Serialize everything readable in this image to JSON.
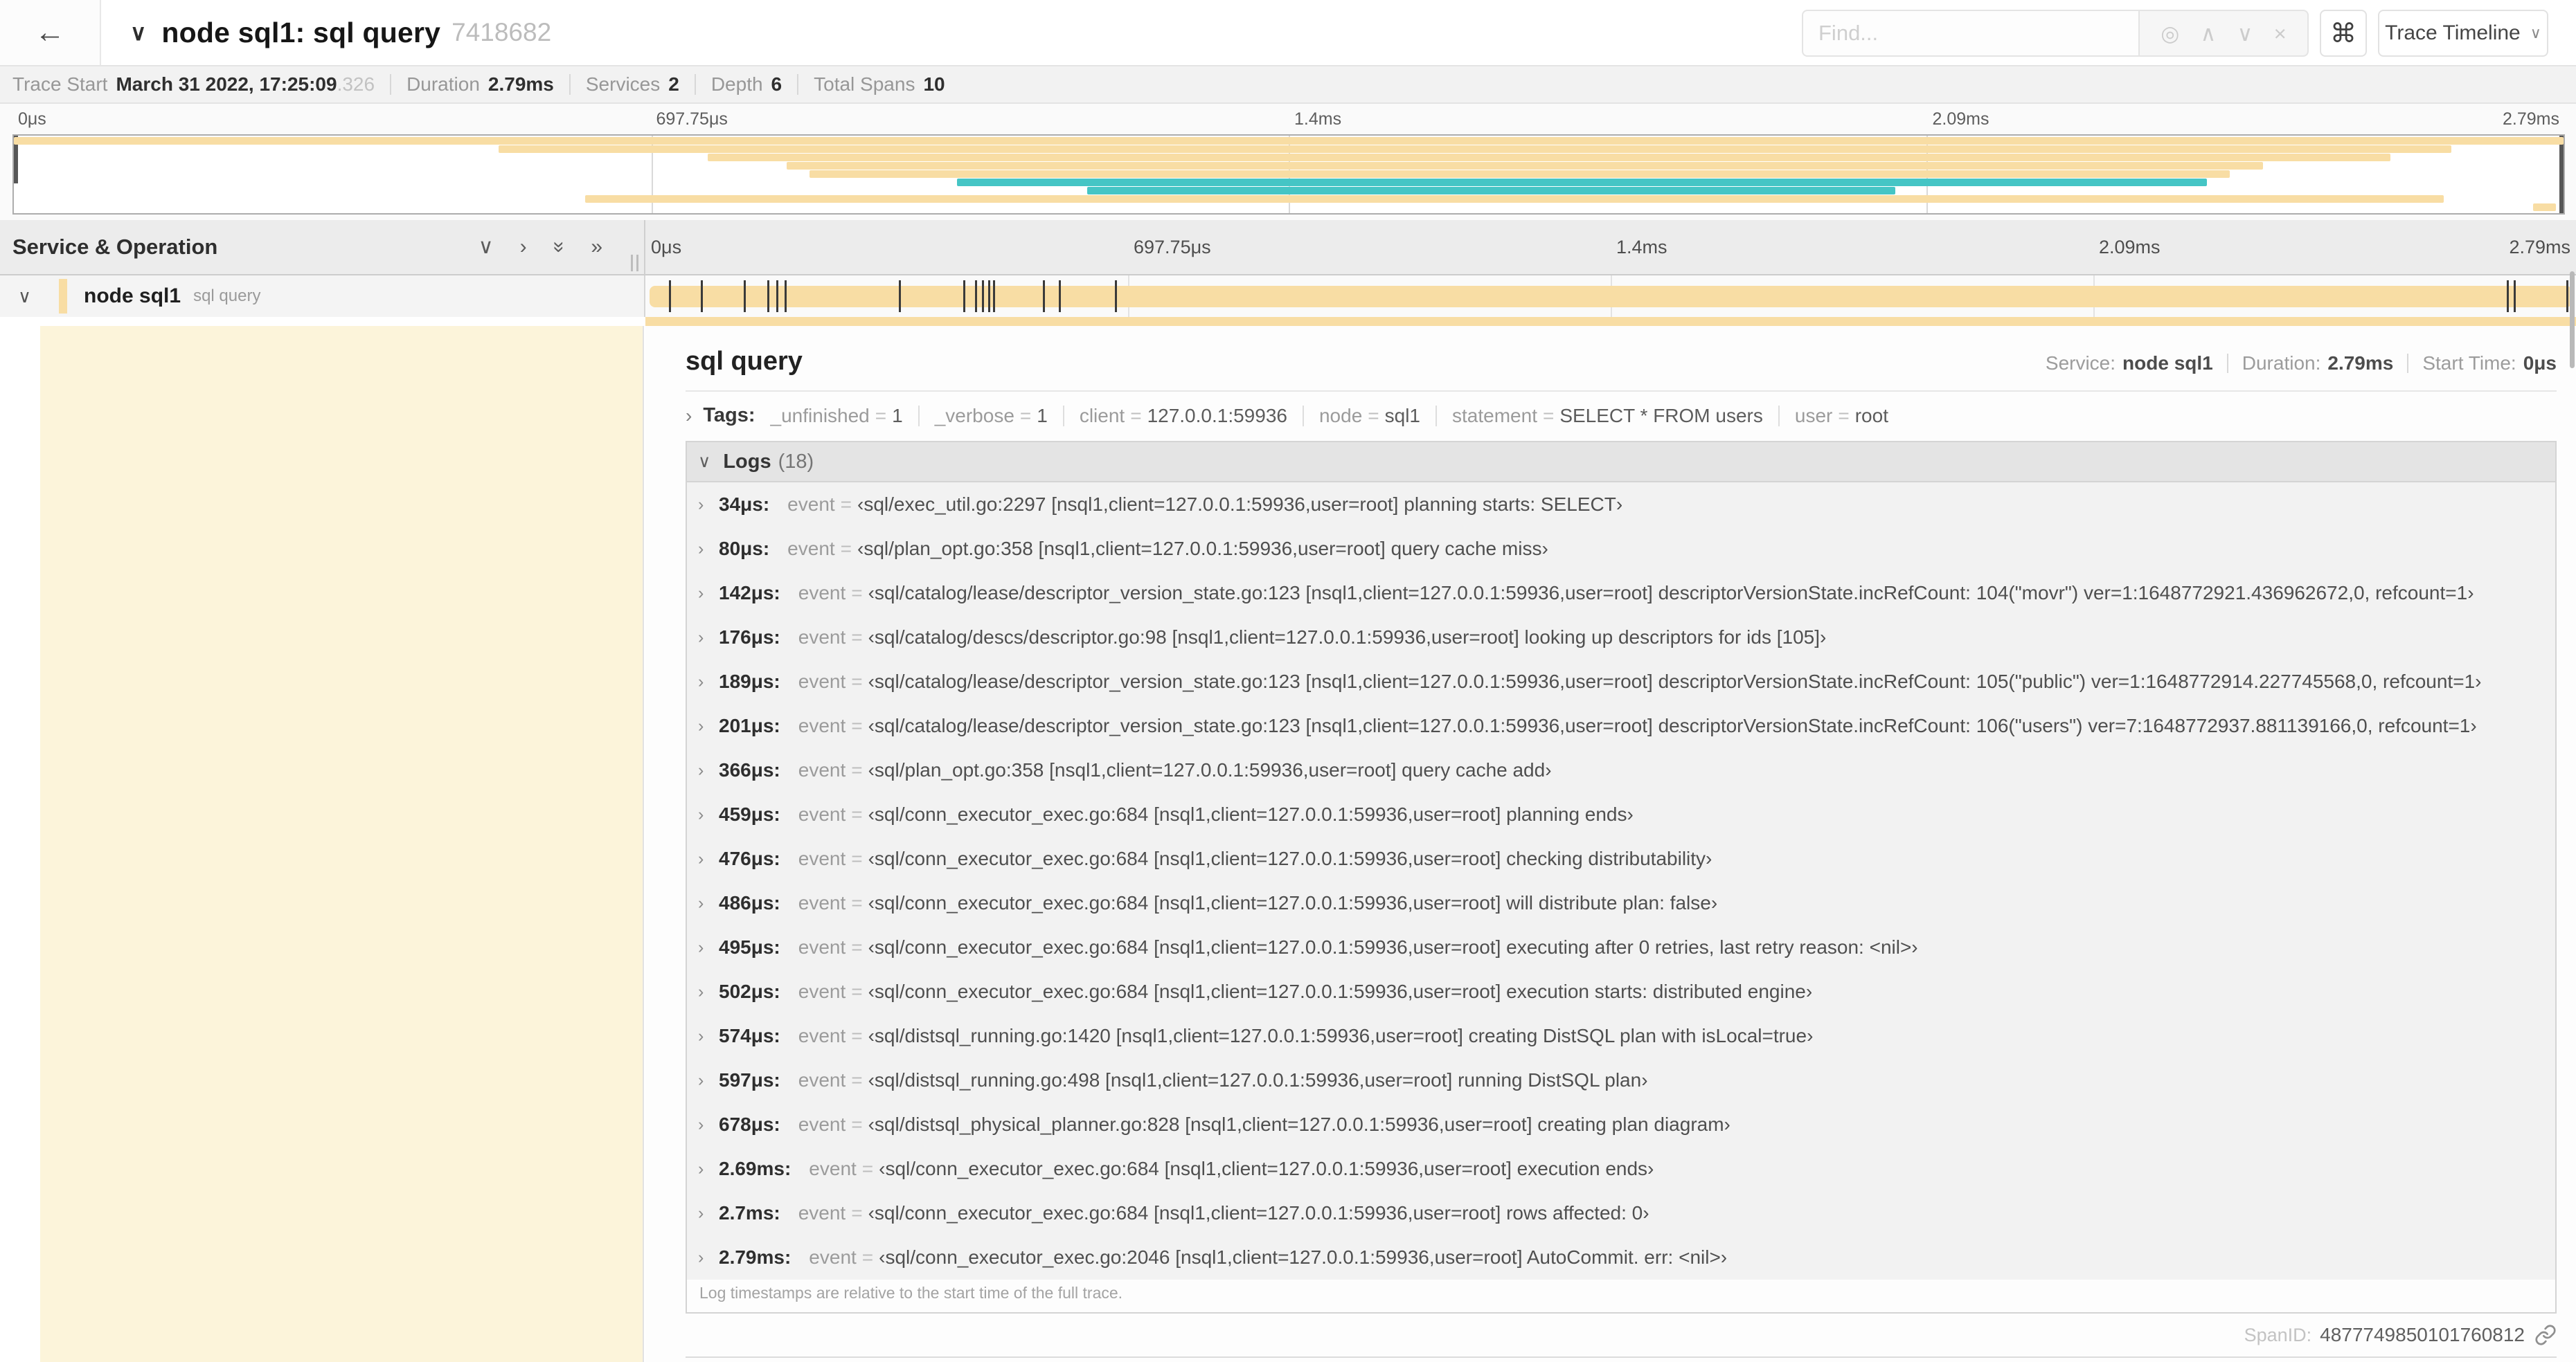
{
  "icons": {
    "back": "←",
    "chevron_down": "∨",
    "chevron_right": "›",
    "double_right": "»",
    "close": "×",
    "up": "∧",
    "down": "∨",
    "locate": "◎",
    "command": "⌘"
  },
  "colors": {
    "tan": "#f8dda4",
    "teal": "#45c5c5",
    "accent": "#f8dda4"
  },
  "header": {
    "title": "node sql1: sql query",
    "trace_id_short": "7418682",
    "find_placeholder": "Find...",
    "view_label": "Trace Timeline"
  },
  "summary": {
    "items": [
      {
        "label": "Trace Start",
        "value": "March 31 2022, 17:25:09",
        "suffix": ".326"
      },
      {
        "label": "Duration",
        "value": "2.79ms",
        "suffix": ""
      },
      {
        "label": "Services",
        "value": "2",
        "suffix": ""
      },
      {
        "label": "Depth",
        "value": "6",
        "suffix": ""
      },
      {
        "label": "Total Spans",
        "value": "10",
        "suffix": ""
      }
    ]
  },
  "minimap": {
    "ticks": [
      "0μs",
      "697.75μs",
      "1.4ms",
      "2.09ms",
      "2.79ms"
    ],
    "spans": [
      {
        "start": 0,
        "end": 100,
        "color": "tan"
      },
      {
        "start": 19,
        "end": 95.6,
        "color": "tan"
      },
      {
        "start": 27.2,
        "end": 93.2,
        "color": "tan"
      },
      {
        "start": 30.3,
        "end": 88.2,
        "color": "tan"
      },
      {
        "start": 31.2,
        "end": 86.9,
        "color": "tan"
      },
      {
        "start": 37.0,
        "end": 86.0,
        "color": "teal"
      },
      {
        "start": 42.1,
        "end": 73.8,
        "color": "teal"
      },
      {
        "start": 22.4,
        "end": 95.3,
        "color": "tan"
      },
      {
        "start": 98.8,
        "end": 99.7,
        "color": "tan"
      }
    ]
  },
  "timeline": {
    "left_header": "Service & Operation",
    "ticks": [
      "0μs",
      "697.75μs",
      "1.4ms",
      "2.09ms",
      "2.79ms"
    ],
    "duration_us": 2790,
    "row": {
      "service": "node sql1",
      "operation": "sql query"
    }
  },
  "detail": {
    "title": "sql query",
    "meta": [
      {
        "label": "Service:",
        "value": "node sql1"
      },
      {
        "label": "Duration:",
        "value": "2.79ms"
      },
      {
        "label": "Start Time:",
        "value": "0μs"
      }
    ],
    "tags": {
      "label": "Tags:",
      "items": [
        {
          "key": "_unfinished",
          "value": "1"
        },
        {
          "key": "_verbose",
          "value": "1"
        },
        {
          "key": "client",
          "value": "127.0.0.1:59936"
        },
        {
          "key": "node",
          "value": "sql1"
        },
        {
          "key": "statement",
          "value": "SELECT * FROM users"
        },
        {
          "key": "user",
          "value": "root"
        }
      ]
    },
    "logs": {
      "label": "Logs",
      "count": "(18)",
      "field": "event",
      "entries": [
        {
          "time": "34μs:",
          "t_us": 34,
          "value": "‹sql/exec_util.go:2297 [nsql1,client=127.0.0.1:59936,user=root] planning starts: SELECT›"
        },
        {
          "time": "80μs:",
          "t_us": 80,
          "value": "‹sql/plan_opt.go:358 [nsql1,client=127.0.0.1:59936,user=root] query cache miss›"
        },
        {
          "time": "142μs:",
          "t_us": 142,
          "value": "‹sql/catalog/lease/descriptor_version_state.go:123 [nsql1,client=127.0.0.1:59936,user=root] descriptorVersionState.incRefCount: 104(\"movr\") ver=1:1648772921.436962672,0, refcount=1›"
        },
        {
          "time": "176μs:",
          "t_us": 176,
          "value": "‹sql/catalog/descs/descriptor.go:98 [nsql1,client=127.0.0.1:59936,user=root] looking up descriptors for ids [105]›"
        },
        {
          "time": "189μs:",
          "t_us": 189,
          "value": "‹sql/catalog/lease/descriptor_version_state.go:123 [nsql1,client=127.0.0.1:59936,user=root] descriptorVersionState.incRefCount: 105(\"public\") ver=1:1648772914.227745568,0, refcount=1›"
        },
        {
          "time": "201μs:",
          "t_us": 201,
          "value": "‹sql/catalog/lease/descriptor_version_state.go:123 [nsql1,client=127.0.0.1:59936,user=root] descriptorVersionState.incRefCount: 106(\"users\") ver=7:1648772937.881139166,0, refcount=1›"
        },
        {
          "time": "366μs:",
          "t_us": 366,
          "value": "‹sql/plan_opt.go:358 [nsql1,client=127.0.0.1:59936,user=root] query cache add›"
        },
        {
          "time": "459μs:",
          "t_us": 459,
          "value": "‹sql/conn_executor_exec.go:684 [nsql1,client=127.0.0.1:59936,user=root] planning ends›"
        },
        {
          "time": "476μs:",
          "t_us": 476,
          "value": "‹sql/conn_executor_exec.go:684 [nsql1,client=127.0.0.1:59936,user=root] checking distributability›"
        },
        {
          "time": "486μs:",
          "t_us": 486,
          "value": "‹sql/conn_executor_exec.go:684 [nsql1,client=127.0.0.1:59936,user=root] will distribute plan: false›"
        },
        {
          "time": "495μs:",
          "t_us": 495,
          "value": "‹sql/conn_executor_exec.go:684 [nsql1,client=127.0.0.1:59936,user=root] executing after 0 retries, last retry reason: <nil>›"
        },
        {
          "time": "502μs:",
          "t_us": 502,
          "value": "‹sql/conn_executor_exec.go:684 [nsql1,client=127.0.0.1:59936,user=root] execution starts: distributed engine›"
        },
        {
          "time": "574μs:",
          "t_us": 574,
          "value": "‹sql/distsql_running.go:1420 [nsql1,client=127.0.0.1:59936,user=root] creating DistSQL plan with isLocal=true›"
        },
        {
          "time": "597μs:",
          "t_us": 597,
          "value": "‹sql/distsql_running.go:498 [nsql1,client=127.0.0.1:59936,user=root] running DistSQL plan›"
        },
        {
          "time": "678μs:",
          "t_us": 678,
          "value": "‹sql/distsql_physical_planner.go:828 [nsql1,client=127.0.0.1:59936,user=root] creating plan diagram›"
        },
        {
          "time": "2.69ms:",
          "t_us": 2690,
          "value": "‹sql/conn_executor_exec.go:684 [nsql1,client=127.0.0.1:59936,user=root] execution ends›"
        },
        {
          "time": "2.7ms:",
          "t_us": 2700,
          "value": "‹sql/conn_executor_exec.go:684 [nsql1,client=127.0.0.1:59936,user=root] rows affected: 0›"
        },
        {
          "time": "2.79ms:",
          "t_us": 2790,
          "value": "‹sql/conn_executor_exec.go:2046 [nsql1,client=127.0.0.1:59936,user=root] AutoCommit. err: <nil>›"
        }
      ],
      "note": "Log timestamps are relative to the start time of the full trace."
    },
    "span_id_label": "SpanID:",
    "span_id": "4877749850101760812"
  }
}
